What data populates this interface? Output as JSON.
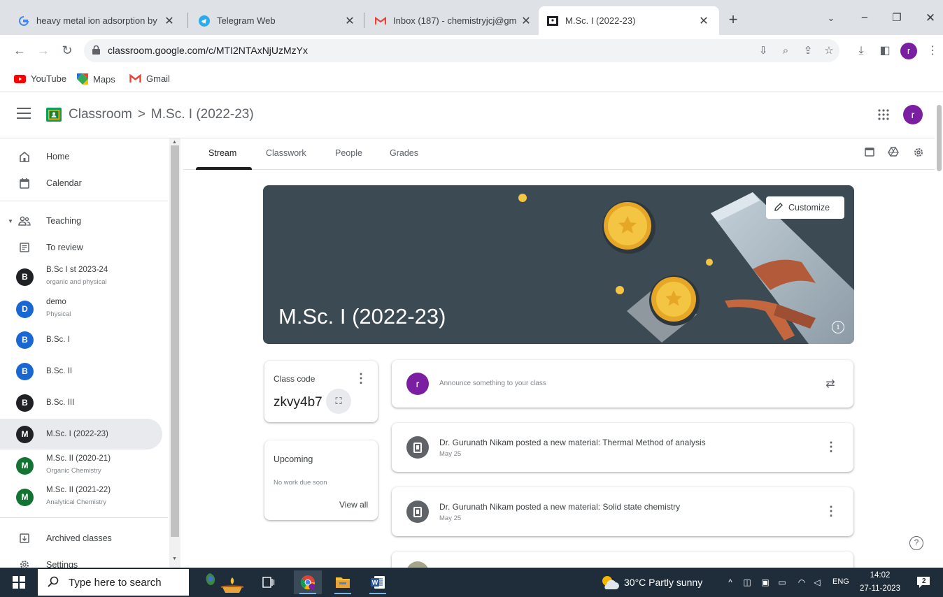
{
  "browser": {
    "tabs": [
      {
        "title": "heavy metal ion adsorption by",
        "icon": "google-icon",
        "active": false
      },
      {
        "title": "Telegram Web",
        "icon": "telegram-icon",
        "active": false
      },
      {
        "title": "Inbox (187) - chemistryjcj@gm",
        "icon": "gmail-icon",
        "active": false
      },
      {
        "title": "M.Sc. I (2022-23)",
        "icon": "classroom-icon",
        "active": true
      }
    ],
    "close_glyph": "✕",
    "new_tab_glyph": "+",
    "url": "classroom.google.com/c/MTI2NTAxNjUzMzYx",
    "profile_initial": "r",
    "bookmarks": [
      {
        "label": "YouTube",
        "icon": "youtube-icon"
      },
      {
        "label": "Maps",
        "icon": "maps-icon"
      },
      {
        "label": "Gmail",
        "icon": "gmail-icon"
      }
    ]
  },
  "app": {
    "name": "Classroom",
    "breadcrumb_sep": ">",
    "class_name": "M.Sc. I (2022-23)",
    "user_initial": "r"
  },
  "sidebar": {
    "home": "Home",
    "calendar": "Calendar",
    "teaching": "Teaching",
    "to_review": "To review",
    "classes": [
      {
        "initial": "B",
        "name": "B.Sc I st 2023-24",
        "section": "organic and physical",
        "color": "#202124"
      },
      {
        "initial": "D",
        "name": "demo",
        "section": "Physical",
        "color": "#1967d2"
      },
      {
        "initial": "B",
        "name": "B.Sc. I",
        "section": "",
        "color": "#1967d2"
      },
      {
        "initial": "B",
        "name": "B.Sc. II",
        "section": "",
        "color": "#1967d2"
      },
      {
        "initial": "B",
        "name": "B.Sc. III",
        "section": "",
        "color": "#202124"
      },
      {
        "initial": "M",
        "name": "M.Sc. I (2022-23)",
        "section": "",
        "color": "#202124"
      },
      {
        "initial": "M",
        "name": "M.Sc. II (2020-21)",
        "section": "Organic Chemistry",
        "color": "#137333"
      },
      {
        "initial": "M",
        "name": "M.Sc. II (2021-22)",
        "section": "Analytical Chemistry",
        "color": "#137333"
      }
    ],
    "archived": "Archived classes",
    "settings": "Settings"
  },
  "tabs": {
    "stream": "Stream",
    "classwork": "Classwork",
    "people": "People",
    "grades": "Grades"
  },
  "banner": {
    "title": "M.Sc. I (2022-23)",
    "customize": "Customize",
    "bg_color": "#3b4a53"
  },
  "class_code": {
    "label": "Class code",
    "value": "zkvy4b7"
  },
  "upcoming": {
    "title": "Upcoming",
    "empty": "No work due soon",
    "view_all": "View all"
  },
  "announce": {
    "avatar_initial": "r",
    "placeholder": "Announce something to your class"
  },
  "posts": [
    {
      "title": "Dr. Gurunath Nikam posted a new material: Thermal Method of analysis",
      "date": "May 25"
    },
    {
      "title": "Dr. Gurunath Nikam posted a new material: Solid state chemistry",
      "date": "May 25"
    }
  ],
  "taskbar": {
    "search_placeholder": "Type here to search",
    "weather": "30°C  Partly sunny",
    "lang": "ENG",
    "time": "14:02",
    "date": "27-11-2023",
    "notification_count": "2"
  }
}
